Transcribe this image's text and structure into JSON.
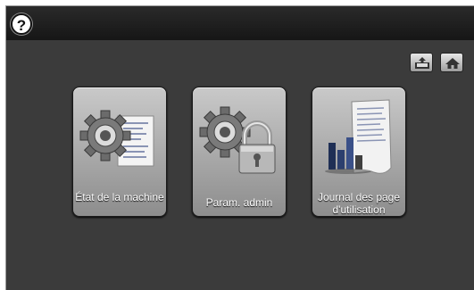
{
  "topbar": {
    "help_glyph": "?",
    "buttons": [
      {
        "icon": "tray-icon"
      },
      {
        "icon": "home-icon"
      }
    ]
  },
  "tiles": [
    {
      "label": "État de la machine",
      "icon": "gear-document-icon"
    },
    {
      "label": "Param. admin",
      "icon": "gear-lock-icon"
    },
    {
      "label": "Journal des page d'utilisation",
      "icon": "usage-report-chart-icon"
    }
  ],
  "colors": {
    "background": "#3b3b3b",
    "topbar": "#1f1f1f",
    "tile_top": "#c9c9c9",
    "tile_bottom": "#8d8d8d"
  }
}
